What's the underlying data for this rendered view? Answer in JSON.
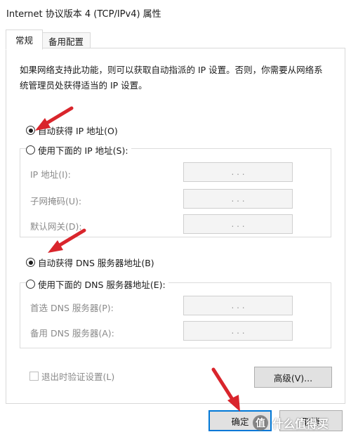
{
  "window": {
    "title": "Internet 协议版本 4 (TCP/IPv4) 属性"
  },
  "tabs": [
    {
      "label": "常规",
      "active": true
    },
    {
      "label": "备用配置",
      "active": false
    }
  ],
  "description": "如果网络支持此功能，则可以获取自动指派的 IP 设置。否则，你需要从网络系统管理员处获得适当的 IP 设置。",
  "ip_section": {
    "auto_option": "自动获得 IP 地址(O)",
    "auto_selected": true,
    "manual_option": "使用下面的 IP 地址(S):",
    "manual_selected": false,
    "fields": [
      {
        "label": "IP 地址(I):",
        "value": ".     .     ."
      },
      {
        "label": "子网掩码(U):",
        "value": ".     .     ."
      },
      {
        "label": "默认网关(D):",
        "value": ".     .     ."
      }
    ]
  },
  "dns_section": {
    "auto_option": "自动获得 DNS 服务器地址(B)",
    "auto_selected": true,
    "manual_option": "使用下面的 DNS 服务器地址(E):",
    "manual_selected": false,
    "fields": [
      {
        "label": "首选 DNS 服务器(P):",
        "value": ".     .     ."
      },
      {
        "label": "备用 DNS 服务器(A):",
        "value": ".     .     ."
      }
    ]
  },
  "validate_checkbox": {
    "label": "退出时验证设置(L)",
    "checked": false
  },
  "buttons": {
    "advanced": "高级(V)...",
    "ok": "确定",
    "cancel": "取消"
  },
  "annotation": {
    "arrow_color": "#d9252c"
  },
  "watermark": {
    "text": "什么值得买",
    "logo": "值"
  }
}
